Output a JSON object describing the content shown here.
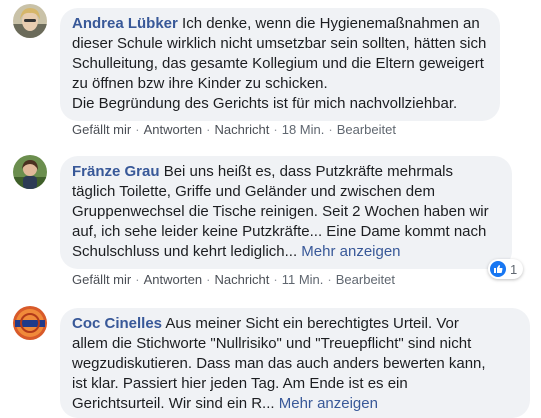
{
  "comments": [
    {
      "name": "Andrea Lübker",
      "lines": [
        "Ich denke, wenn die Hygienemaßnahmen an",
        "dieser Schule wirklich nicht umsetzbar sein sollten, hätten sich",
        "Schulleitung, das gesamte Kollegium und die Eltern geweigert",
        "zu öffnen bzw ihre Kinder zu schicken.",
        "Die Begründung des Gerichts ist für mich nachvollziehbar."
      ],
      "more": "",
      "actions": {
        "like": "Gefällt mir",
        "reply": "Antworten",
        "message": "Nachricht",
        "time": "18 Min.",
        "edited": "Bearbeitet"
      }
    },
    {
      "name": "Fränze Grau",
      "lines": [
        "Bei uns heißt es, dass Putzkräfte mehrmals",
        "täglich Toilette, Griffe und Geländer und zwischen dem",
        "Gruppenwechsel die Tische reinigen. Seit 2 Wochen haben wir",
        "auf, ich sehe leider keine Putzkräfte... Eine Dame kommt nach",
        "Schulschluss und kehrt lediglich..."
      ],
      "more": "Mehr anzeigen",
      "actions": {
        "like": "Gefällt mir",
        "reply": "Antworten",
        "message": "Nachricht",
        "time": "11 Min.",
        "edited": "Bearbeitet"
      },
      "reaction_count": "1"
    },
    {
      "name": "Coc Cinelles",
      "lines": [
        "Aus meiner Sicht ein berechtigtes Urteil. Vor",
        "allem die Stichworte \"Nullrisiko\" und \"Treuepflicht\" sind nicht",
        "wegzudiskutieren. Dass man das auch anders bewerten kann,",
        "ist klar. Passiert hier jeden Tag. Am Ende ist es ein",
        "Gerichtsurteil. Wir sind ein R..."
      ],
      "more": "Mehr anzeigen"
    }
  ],
  "colors": {
    "name": "#385898",
    "bubble": "#f0f2f5",
    "like_blue": "#1877f2"
  }
}
